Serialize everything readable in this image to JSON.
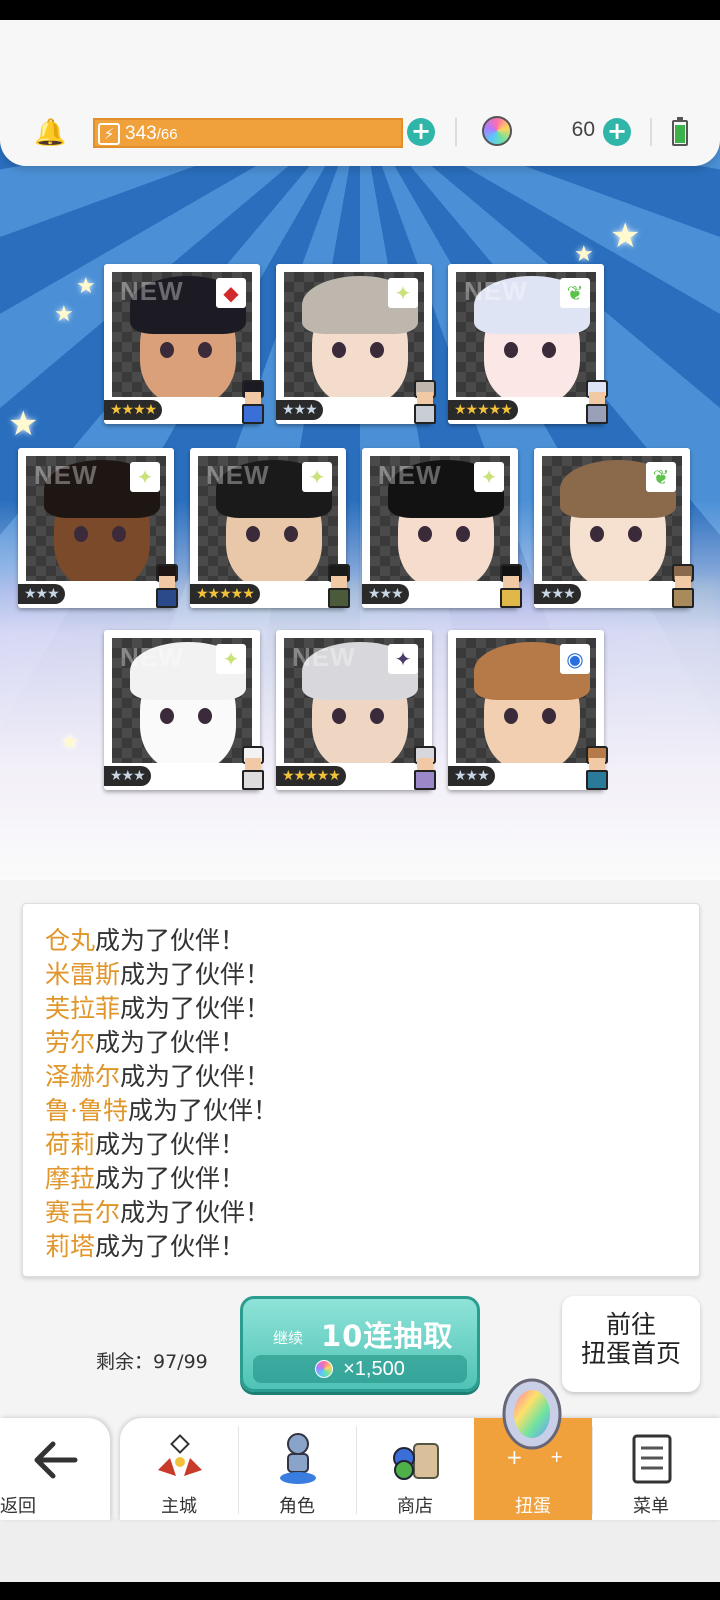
{
  "top_bar": {
    "stamina_current": "343",
    "stamina_max": "/66",
    "gem_count": "60",
    "stamina_plus": "+",
    "gem_plus": "+"
  },
  "cards": [
    {
      "new": "NEW",
      "rarity": "★★★★",
      "element": "red-diamond",
      "element_glyph": "◆",
      "rarity_color": "gold"
    },
    {
      "new": "",
      "rarity": "★★★",
      "element": "sparkle",
      "element_glyph": "✦",
      "rarity_color": "silver"
    },
    {
      "new": "NEW",
      "rarity": "★★★★★",
      "element": "leaf",
      "element_glyph": "❦",
      "rarity_color": "gold"
    },
    {
      "new": "NEW",
      "rarity": "★★★",
      "element": "sparkle",
      "element_glyph": "✦",
      "rarity_color": "silver"
    },
    {
      "new": "NEW",
      "rarity": "★★★★★",
      "element": "sparkle",
      "element_glyph": "✦",
      "rarity_color": "gold"
    },
    {
      "new": "NEW",
      "rarity": "★★★",
      "element": "sparkle",
      "element_glyph": "✦",
      "rarity_color": "silver"
    },
    {
      "new": "",
      "rarity": "★★★",
      "element": "leaf",
      "element_glyph": "❦",
      "rarity_color": "silver"
    },
    {
      "new": "NEW",
      "rarity": "★★★",
      "element": "sparkle",
      "element_glyph": "✦",
      "rarity_color": "silver"
    },
    {
      "new": "NEW",
      "rarity": "★★★★★",
      "element": "dark-star",
      "element_glyph": "✦",
      "rarity_color": "gold"
    },
    {
      "new": "",
      "rarity": "★★★",
      "element": "blue-circle",
      "element_glyph": "◉",
      "rarity_color": "silver"
    }
  ],
  "log": {
    "suffix": "成为了伙伴！",
    "names": [
      "仓丸",
      "米雷斯",
      "芙拉菲",
      "劳尔",
      "泽赫尔",
      "鲁·鲁特",
      "荷莉",
      "摩菈",
      "赛吉尔",
      "莉塔"
    ]
  },
  "actions": {
    "remaining": "剩余：97/99",
    "continue_label": "继续",
    "gacha_label": "10连抽取",
    "cost": "×1,500",
    "goto_line1": "前往",
    "goto_line2": "扭蛋首页"
  },
  "nav": {
    "back": "返回",
    "tabs": [
      "主城",
      "角色",
      "商店",
      "扭蛋",
      "菜单"
    ],
    "active_tab": "扭蛋"
  },
  "colors": {
    "accent_orange": "#f0a13c",
    "teal": "#2fb6a8",
    "name_orange": "#e0962a"
  }
}
